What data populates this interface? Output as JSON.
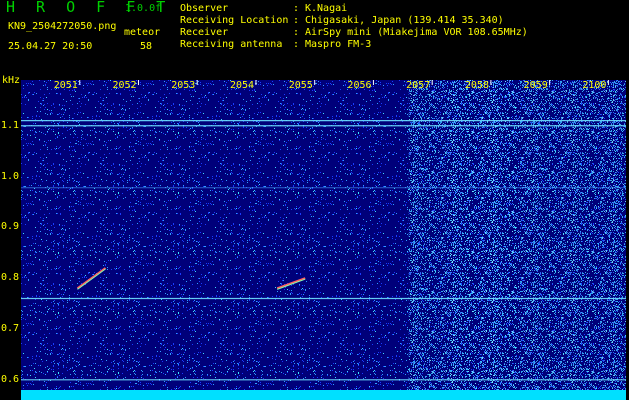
{
  "header": {
    "brand": "H R O F F T",
    "version": "1.0.0f",
    "filename": "KN9_2504272050.png",
    "meteor_label": "meteor",
    "datetime": "25.04.27 20:50",
    "meteor_count": "58"
  },
  "info": [
    {
      "key": "Observer",
      "value": "K.Nagai"
    },
    {
      "key": "Receiving Location",
      "value": "Chigasaki, Japan (139.414 35.340)"
    },
    {
      "key": "Receiver",
      "value": "AirSpy mini (Miakejima VOR 108.65MHz)"
    },
    {
      "key": "Receiving antenna",
      "value": "Maspro FM-3"
    }
  ],
  "colors": {
    "text": "#ffff00",
    "brand": "#00d000",
    "background": "#00007a",
    "baseline": "#00e0ff"
  },
  "chart_data": {
    "type": "heatmap",
    "ylabel": "kHz",
    "x_ticks": [
      "2051",
      "2052",
      "2053",
      "2054",
      "2055",
      "2056",
      "2057",
      "2058",
      "2059",
      "2100"
    ],
    "y_ticks": [
      "1.1",
      "1.0",
      "0.9",
      "0.8",
      "0.7",
      "0.6"
    ],
    "ylim": [
      0.58,
      1.19
    ],
    "xlim": [
      "20:50",
      "21:00"
    ],
    "meteor_echoes": [
      {
        "time_min": 1.2,
        "freq_khz_start": 0.78,
        "freq_khz_end": 0.82
      },
      {
        "time_min": 4.6,
        "freq_khz_start": 0.78,
        "freq_khz_end": 0.8
      }
    ],
    "carrier_lines_khz": [
      1.1,
      1.11,
      0.76,
      0.6
    ]
  }
}
